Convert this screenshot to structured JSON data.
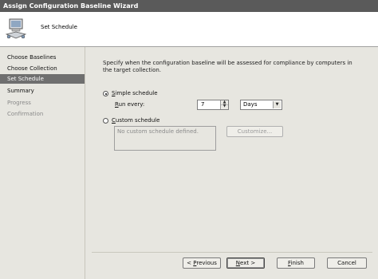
{
  "window": {
    "title": "Assign Configuration Baseline Wizard"
  },
  "header": {
    "title": "Set Schedule",
    "icon": "computer-network-icon"
  },
  "sidebar": {
    "items": [
      {
        "label": "Choose Baselines",
        "state": "normal"
      },
      {
        "label": "Choose Collection",
        "state": "normal"
      },
      {
        "label": "Set Schedule",
        "state": "active"
      },
      {
        "label": "Summary",
        "state": "normal"
      },
      {
        "label": "Progress",
        "state": "disabled"
      },
      {
        "label": "Confirmation",
        "state": "disabled"
      }
    ]
  },
  "main": {
    "description": "Specify when the configuration baseline will be assessed for compliance by computers in the target collection.",
    "simple_schedule": {
      "label_accel": "S",
      "label_rest": "imple schedule",
      "selected": true,
      "run_every_accel": "R",
      "run_every_rest": "un every:",
      "interval_value": "7",
      "interval_unit": "Days"
    },
    "custom_schedule": {
      "label_accel": "C",
      "label_rest": "ustom schedule",
      "selected": false,
      "empty_text": "No custom schedule defined.",
      "customize_button": "Customize..."
    }
  },
  "footer": {
    "previous_accel": "P",
    "previous_prefix": "< ",
    "previous_rest": "revious",
    "next_accel": "N",
    "next_rest": "ext >",
    "finish_accel": "F",
    "finish_rest": "inish",
    "cancel": "Cancel"
  }
}
